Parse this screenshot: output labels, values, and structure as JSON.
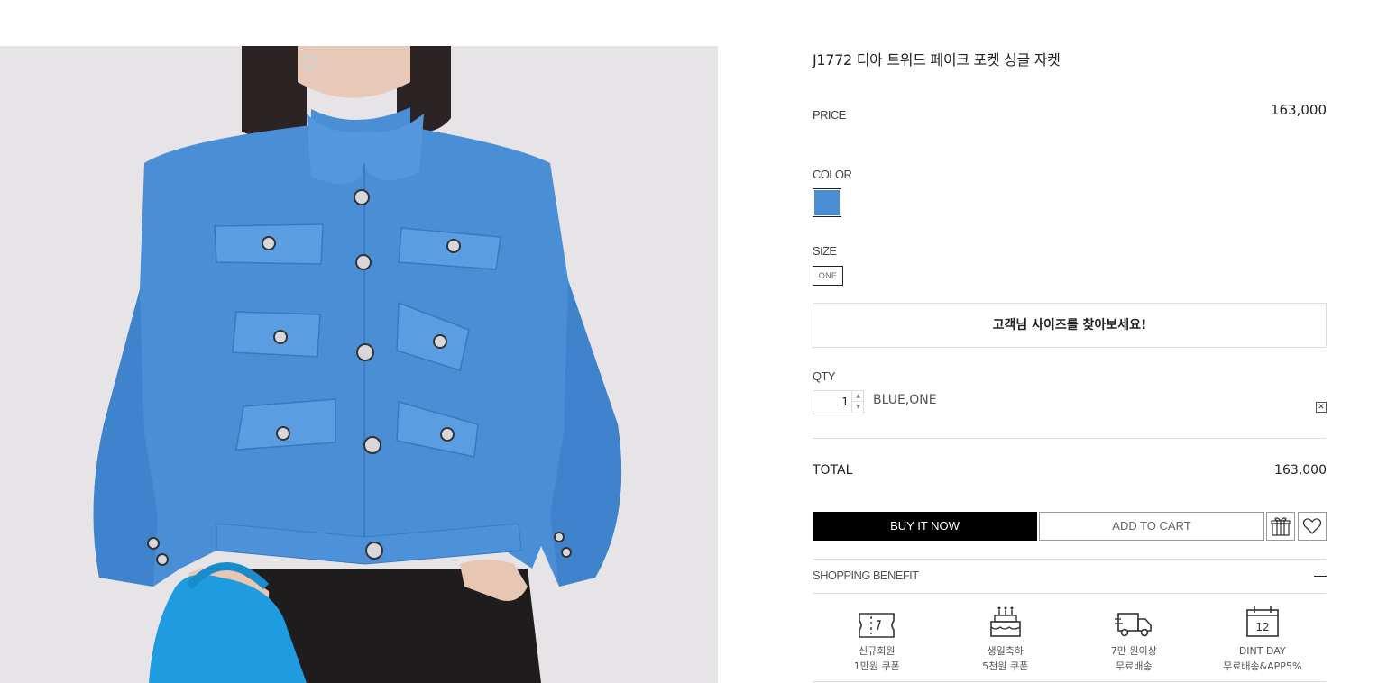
{
  "product": {
    "title": "J1772 디아 트위드 페이크 포켓 싱글 자켓",
    "price_label": "PRICE",
    "price": "163,000",
    "color_label": "COLOR",
    "color_swatch": "#4a8fd6",
    "size_label": "SIZE",
    "size_option": "ONE",
    "find_size": "고객님 사이즈를 찾아보세요!",
    "qty_label": "QTY",
    "qty": "1",
    "qty_up": "▲",
    "qty_down": "▼",
    "selected_option": "BLUE,ONE",
    "remove_symbol": "✕",
    "total_label": "TOTAL",
    "total": "163,000"
  },
  "actions": {
    "buy_now": "BUY IT NOW",
    "add_to_cart": "ADD TO CART",
    "gift_icon": "gift-icon",
    "wishlist_icon": "heart-icon"
  },
  "benefits": {
    "label": "SHOPPING BENEFIT",
    "items": [
      {
        "icon": "ticket-icon",
        "line1": "신규회원",
        "line2": "1만원 쿠폰"
      },
      {
        "icon": "cake-icon",
        "line1": "생일축하",
        "line2": "5천원 쿠폰"
      },
      {
        "icon": "truck-icon",
        "line1": "7만 원이상",
        "line2": "무료배송"
      },
      {
        "icon": "calendar-icon",
        "calendar_day": "12",
        "line1": "DINT DAY",
        "line2": "무료배송&APP5%"
      }
    ]
  },
  "colors": {
    "jacket_blue": "#4a8fd6",
    "bag_blue": "#1f9be0",
    "button_black": "#000000"
  }
}
